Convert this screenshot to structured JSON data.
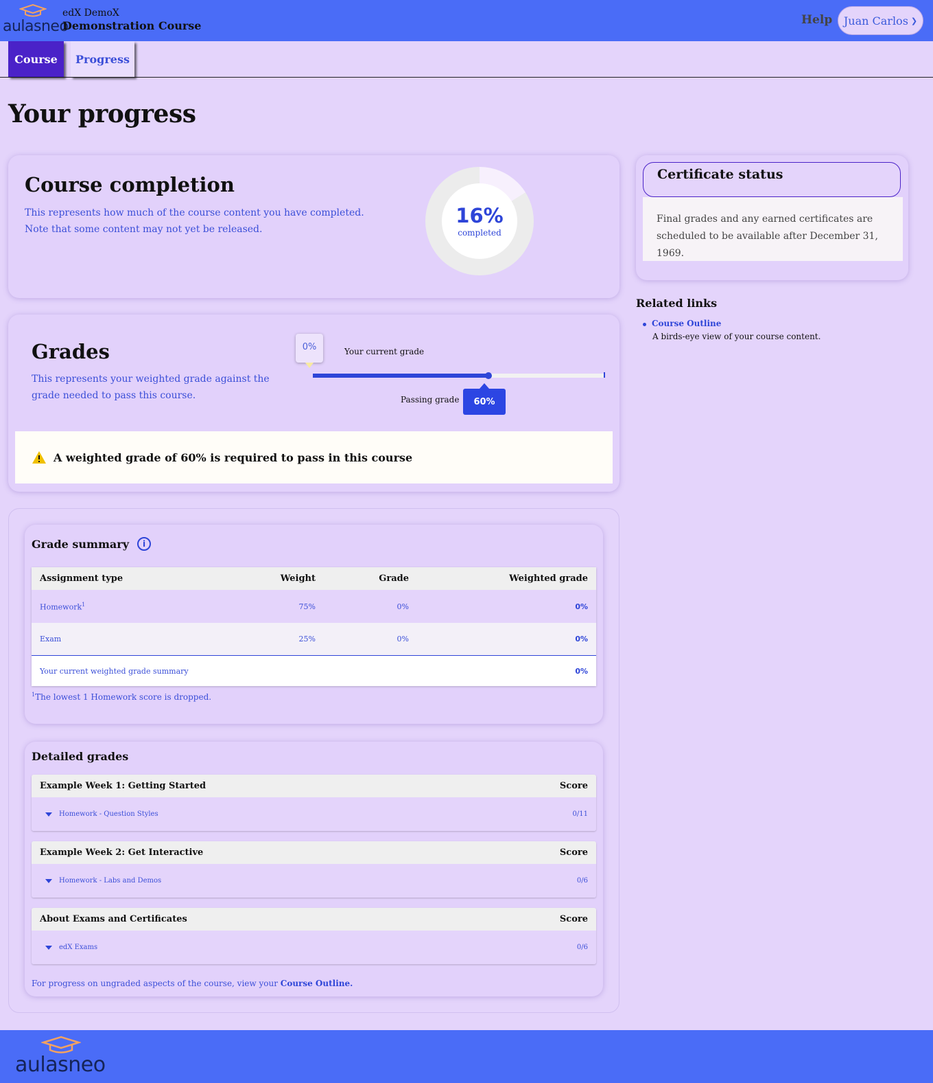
{
  "brand": {
    "logo_text": "aulasneo",
    "accent": "#4a6cf7"
  },
  "header": {
    "course_org": "edX DemoX",
    "course_title": "Demonstration Course",
    "help": "Help",
    "user": "Juan Carlos",
    "user_icon": "chevron-down-icon"
  },
  "tabs": [
    {
      "label": "Course",
      "active": false
    },
    {
      "label": "Progress",
      "active": true
    }
  ],
  "page_title": "Your progress",
  "completion": {
    "title": "Course completion",
    "description": "This represents how much of the course content you have completed. Note that some content may not yet be released.",
    "percent_text": "16%",
    "percent_value": 0.16,
    "completed_label": "completed"
  },
  "grades": {
    "title": "Grades",
    "description": "This represents your weighted grade against the grade needed to pass this course.",
    "current_grade_text": "0%",
    "current_grade_value": 0,
    "current_grade_label": "Your current grade",
    "passing_grade_label": "Passing grade",
    "passing_grade_text": "60%",
    "passing_grade_value": 0.6,
    "warning": "A weighted grade of 60% is required to pass in this course"
  },
  "grade_summary": {
    "title": "Grade summary",
    "columns": [
      "Assignment type",
      "Weight",
      "Grade",
      "Weighted grade"
    ],
    "rows": [
      {
        "type": "Homework",
        "footnote_mark": "1",
        "weight": "75%",
        "grade": "0%",
        "weighted": "0%"
      },
      {
        "type": "Exam",
        "weight": "25%",
        "grade": "0%",
        "weighted": "0%"
      }
    ],
    "total_label": "Your current weighted grade summary",
    "total_value": "0%",
    "footnote_mark": "1",
    "footnote": "The lowest 1 Homework score is dropped."
  },
  "detailed_grades": {
    "title": "Detailed grades",
    "score_label": "Score",
    "sections": [
      {
        "title": "Example Week 1: Getting Started",
        "subsection": "Homework - Question Styles",
        "score": "0/11"
      },
      {
        "title": "Example Week 2: Get Interactive",
        "subsection": "Homework - Labs and Demos",
        "score": "0/6"
      },
      {
        "title": "About Exams and Certificates",
        "subsection": "edX Exams",
        "score": "0/6"
      }
    ],
    "footer_text": "For progress on ungraded aspects of the course, view your ",
    "footer_link": "Course Outline."
  },
  "certificate": {
    "title": "Certificate status",
    "body": "Final grades and any earned certificates are scheduled to be available after December 31, 1969."
  },
  "related": {
    "title": "Related links",
    "items": [
      {
        "label": "Course Outline",
        "description": "A birds-eye view of your course content."
      }
    ]
  }
}
